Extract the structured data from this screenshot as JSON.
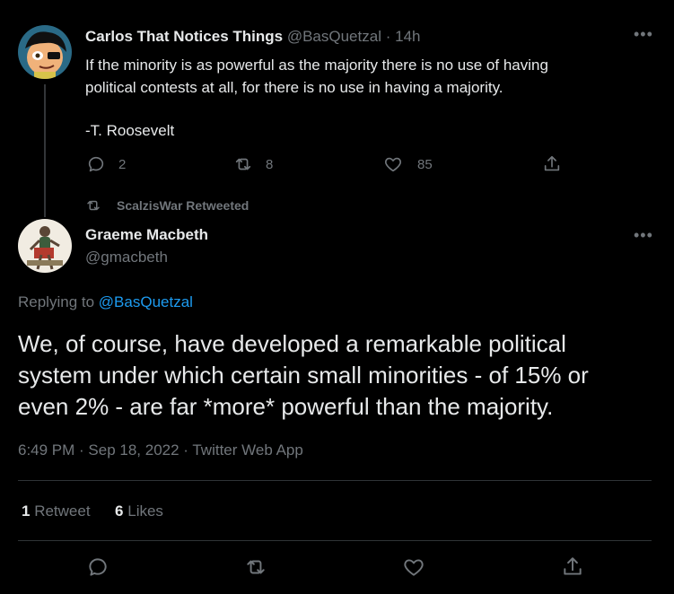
{
  "parent_tweet": {
    "display_name": "Carlos That Notices Things",
    "handle": "@BasQuetzal",
    "separator": "·",
    "time": "14h",
    "text_line1": "If the minority is as powerful as the majority there is no use of having",
    "text_line2": "political contests at all, for there is no use in having a majority.",
    "text_line3": "-T. Roosevelt",
    "replies": "2",
    "retweets": "8",
    "likes": "85"
  },
  "retweeted_by": "ScalzisWar Retweeted",
  "main_tweet": {
    "display_name": "Graeme Macbeth",
    "handle": "@gmacbeth",
    "replying_prefix": "Replying to",
    "replying_to": "@BasQuetzal",
    "text_line1": "We, of course, have developed a remarkable political",
    "text_line2": "system under which certain small minorities - of 15% or",
    "text_line3": "even 2% - are far *more* powerful than the majority.",
    "meta": "6:49 PM · Sep 18, 2022 · Twitter Web App",
    "retweet_count": "1",
    "retweet_label": "Retweet",
    "like_count": "6",
    "like_label": "Likes"
  },
  "icons": [
    "reply-icon",
    "retweet-icon",
    "like-icon",
    "share-icon",
    "more-icon"
  ],
  "colors": {
    "background": "#000000",
    "text": "#e7e9ea",
    "muted": "#71767b",
    "link": "#1d9bf0",
    "divider": "#2f3336"
  }
}
